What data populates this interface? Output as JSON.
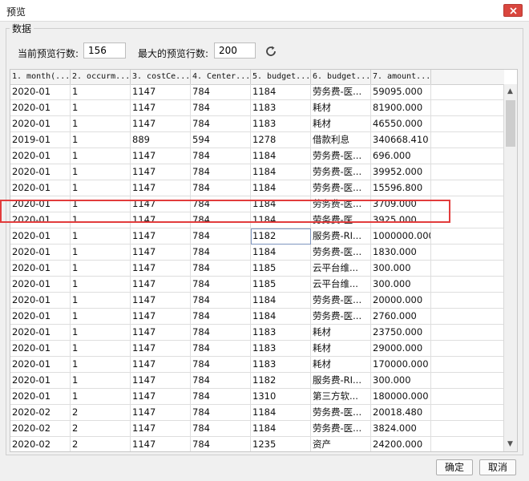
{
  "window": {
    "title": "预览"
  },
  "group": {
    "label": "数据"
  },
  "preview": {
    "current_label": "当前预览行数:",
    "current_value": "156",
    "max_label": "最大的预览行数:",
    "max_value": "200"
  },
  "table": {
    "headers": [
      "1. month(...",
      "2. occurm...",
      "3. costCe...",
      "4. Center...",
      "5. budget...",
      "6. budget...",
      "7. amount..."
    ],
    "rows": [
      [
        "2020-01",
        "1",
        "1147",
        "784",
        "1184",
        "劳务费-医...",
        "59095.000"
      ],
      [
        "2020-01",
        "1",
        "1147",
        "784",
        "1183",
        "耗材",
        "81900.000"
      ],
      [
        "2020-01",
        "1",
        "1147",
        "784",
        "1183",
        "耗材",
        "46550.000"
      ],
      [
        "2019-01",
        "1",
        "889",
        "594",
        "1278",
        "借款利息",
        "340668.410"
      ],
      [
        "2020-01",
        "1",
        "1147",
        "784",
        "1184",
        "劳务费-医...",
        "696.000"
      ],
      [
        "2020-01",
        "1",
        "1147",
        "784",
        "1184",
        "劳务费-医...",
        "39952.000"
      ],
      [
        "2020-01",
        "1",
        "1147",
        "784",
        "1184",
        "劳务费-医...",
        "15596.800"
      ],
      [
        "2020-01",
        "1",
        "1147",
        "784",
        "1184",
        "劳务费-医...",
        "3709.000"
      ],
      [
        "2020-01",
        "1",
        "1147",
        "784",
        "1184",
        "劳务费-医...",
        "3925.000"
      ],
      [
        "2020-01",
        "1",
        "1147",
        "784",
        "1182",
        "服务费-RI...",
        "1000000.000"
      ],
      [
        "2020-01",
        "1",
        "1147",
        "784",
        "1184",
        "劳务费-医...",
        "1830.000"
      ],
      [
        "2020-01",
        "1",
        "1147",
        "784",
        "1185",
        "云平台维...",
        "300.000"
      ],
      [
        "2020-01",
        "1",
        "1147",
        "784",
        "1185",
        "云平台维...",
        "300.000"
      ],
      [
        "2020-01",
        "1",
        "1147",
        "784",
        "1184",
        "劳务费-医...",
        "20000.000"
      ],
      [
        "2020-01",
        "1",
        "1147",
        "784",
        "1184",
        "劳务费-医...",
        "2760.000"
      ],
      [
        "2020-01",
        "1",
        "1147",
        "784",
        "1183",
        "耗材",
        "23750.000"
      ],
      [
        "2020-01",
        "1",
        "1147",
        "784",
        "1183",
        "耗材",
        "29000.000"
      ],
      [
        "2020-01",
        "1",
        "1147",
        "784",
        "1183",
        "耗材",
        "170000.000"
      ],
      [
        "2020-01",
        "1",
        "1147",
        "784",
        "1182",
        "服务费-RI...",
        "300.000"
      ],
      [
        "2020-01",
        "1",
        "1147",
        "784",
        "1310",
        "第三方软...",
        "180000.000"
      ],
      [
        "2020-02",
        "2",
        "1147",
        "784",
        "1184",
        "劳务费-医...",
        "20018.480"
      ],
      [
        "2020-02",
        "2",
        "1147",
        "784",
        "1184",
        "劳务费-医...",
        "3824.000"
      ],
      [
        "2020-02",
        "2",
        "1147",
        "784",
        "1235",
        "资产",
        "24200.000"
      ]
    ]
  },
  "buttons": {
    "ok": "确定",
    "cancel": "取消"
  },
  "colors": {
    "highlight": "#e23c3c",
    "close": "#d9463e"
  }
}
